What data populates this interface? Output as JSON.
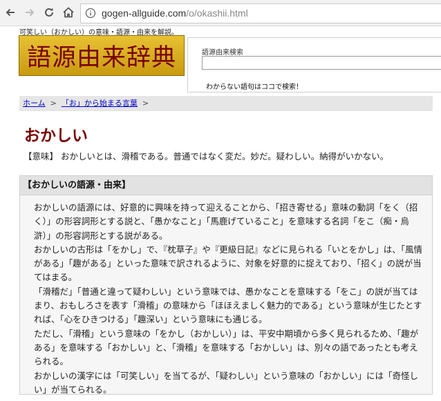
{
  "browser": {
    "url_domain": "gogen-allguide.com",
    "url_path": "/o/okashii.html"
  },
  "header": {
    "tagline": "可笑しい（おかしい）の意味・語源・由来を解説。",
    "logo_text": "語源由来辞典",
    "search_label": "語源由来検索",
    "search_value": "",
    "search_hint": "わからない語句はココで検索！"
  },
  "breadcrumb": {
    "home": "ホーム",
    "category": "「お」から始まる言葉",
    "separator": ">"
  },
  "entry": {
    "title": "おかしい",
    "meaning": "【意味】 おかしいとは、滑稽である。普通ではなく変だ。妙だ。疑わしい。納得がいかない。",
    "origin_heading": "【おかしいの語源・由来】",
    "origin_paragraphs": [
      "おかしいの語源には、好意的に興味を持って迎えることから、「招き寄せる」意味の動詞「をく（招く）」の形容詞形とする説と、「愚かなこと」「馬鹿げていること」を意味する名詞「をこ（痴・烏滸）」の形容詞形とする説がある。",
      "おかしいの古形は「をかし」で、『枕草子』や『更級日記』などに見られる「いとをかし」は、「風情がある」「趣がある」といった意味で訳されるように、対象を好意的に捉えており、「招く」の説が当てはまる。",
      "「滑稽だ」「普通と違って疑わしい」という意味では、愚かなことを意味する「をこ」の説が当てはまり、おもしろさを表す「滑稽」の意味から「ほほえましく魅力的である」という意味が生じたとすれば、「心をひきつける」「趣深い」という意味にも通じる。",
      "ただし、「滑稽」という意味の「をかし（おかしい）」は、平安中期頃から多く見られるため、「趣がある」を意味する「おかしい」と、「滑稽」を意味する「おかしい」は、別々の語であったとも考えられる。",
      "おかしいの漢字には「可笑しい」を当てるが、「疑わしい」という意味の「おかしい」には「奇怪しい」が当てられる。"
    ]
  }
}
